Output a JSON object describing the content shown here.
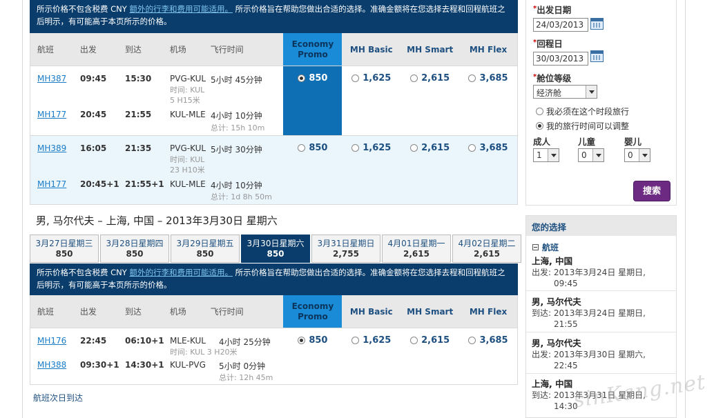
{
  "notice": {
    "prefix": "所示价格不包含税费 CNY ",
    "link": "额外的行李和费用可能适用。",
    "suffix": " 所示价格旨在帮助您做出合适的选择。准确金额将在您选择去程和回程航班之后明示，有可能高于本页所示的价格。"
  },
  "columns": {
    "flight": "航班",
    "depart": "出发",
    "arrive": "到达",
    "airport": "机场",
    "duration": "飞行时间",
    "fares": [
      "Economy Promo",
      "MH Basic",
      "MH Smart",
      "MH Flex"
    ]
  },
  "outbound": [
    {
      "legs": [
        {
          "flight": "MH387",
          "dep": "09:45",
          "arr": "15:30",
          "route": "PVG-KUL",
          "dur": "5小时 45分钟",
          "transit_label": "时间: KUL",
          "transit_time": "5 H15米"
        },
        {
          "flight": "MH177",
          "dep": "20:45",
          "arr": "21:55",
          "route": "KUL-MLE",
          "dur": "4小时 10分钟",
          "total": "总计: 15h 10m"
        }
      ],
      "prices": [
        "850",
        "1,625",
        "2,615",
        "3,685"
      ],
      "selected": 0
    },
    {
      "legs": [
        {
          "flight": "MH389",
          "dep": "16:05",
          "arr": "21:35",
          "route": "PVG-KUL",
          "dur": "5小时 30分钟",
          "transit_label": "时间: KUL",
          "transit_time": "23 H10米"
        },
        {
          "flight": "MH177",
          "dep": "20:45+1",
          "arr": "21:55+1",
          "route": "KUL-MLE",
          "dur": "4小时 10分钟",
          "total": "总计: 1d 8h 50m"
        }
      ],
      "prices": [
        "850",
        "1,625",
        "2,615",
        "3,685"
      ],
      "selected": null
    }
  ],
  "return_title": "男, 马尔代夫 – 上海, 中国 – 2013年3月30日 星期六",
  "date_tabs": [
    {
      "label": "3月27日星期三",
      "price": "850"
    },
    {
      "label": "3月28日星期四",
      "price": "850"
    },
    {
      "label": "3月29日星期五",
      "price": "850"
    },
    {
      "label": "3月30日星期六",
      "price": "850",
      "active": true
    },
    {
      "label": "3月31日星期日",
      "price": "2,755"
    },
    {
      "label": "4月01日星期一",
      "price": "2,615"
    },
    {
      "label": "4月02日星期二",
      "price": "2,615"
    }
  ],
  "inbound": [
    {
      "legs": [
        {
          "flight": "MH176",
          "dep": "22:45",
          "arr": "06:10+1",
          "route": "MLE-KUL",
          "dur": "4小时 25分钟",
          "transit_label": "时间: KUL 3 H20米"
        },
        {
          "flight": "MH388",
          "dep": "09:30+1",
          "arr": "14:30+1",
          "route": "KUL-PVG",
          "dur": "5小时 0分钟",
          "total": "总计: 12h 45m"
        }
      ],
      "prices": [
        "850",
        "1,625",
        "2,615",
        "3,685"
      ],
      "selected": 0
    }
  ],
  "next_day_link": "航班次日到达",
  "search": {
    "depart_label": "出发日期",
    "depart_value": "24/03/2013",
    "return_label": "回程日",
    "return_value": "30/03/2013",
    "class_label": "舱位等级",
    "class_value": "经济舱",
    "opt_fixed": "我必须在这个时段旅行",
    "opt_flexible": "我的旅行时间可以调整",
    "adult_label": "成人",
    "adult_value": "1",
    "child_label": "儿童",
    "child_value": "0",
    "infant_label": "婴儿",
    "infant_value": "0",
    "search_button": "搜索"
  },
  "selection": {
    "title": "您的选择",
    "section": "航班",
    "items": [
      {
        "city": "上海, 中国",
        "label": "出发:",
        "date": "2013年3月24日 星期日,",
        "time": "09:45"
      },
      {
        "city": "男, 马尔代夫",
        "label": "到达:",
        "date": "2013年3月24日 星期日,",
        "time": "21:55"
      },
      {
        "city": "男, 马尔代夫",
        "label": "出发:",
        "date": "2013年3月30日 星期六,",
        "time": "22:45"
      },
      {
        "city": "上海, 中国",
        "label": "到达:",
        "date": "2013年3月31日 星期日,",
        "time": "14:30"
      }
    ]
  },
  "watermark": "sinKang.net",
  "colors": {
    "navy": "#0a3d6b",
    "promo_blue": "#0f6fb5",
    "link": "#1a7cc7",
    "search_purple": "#6d2a82"
  }
}
